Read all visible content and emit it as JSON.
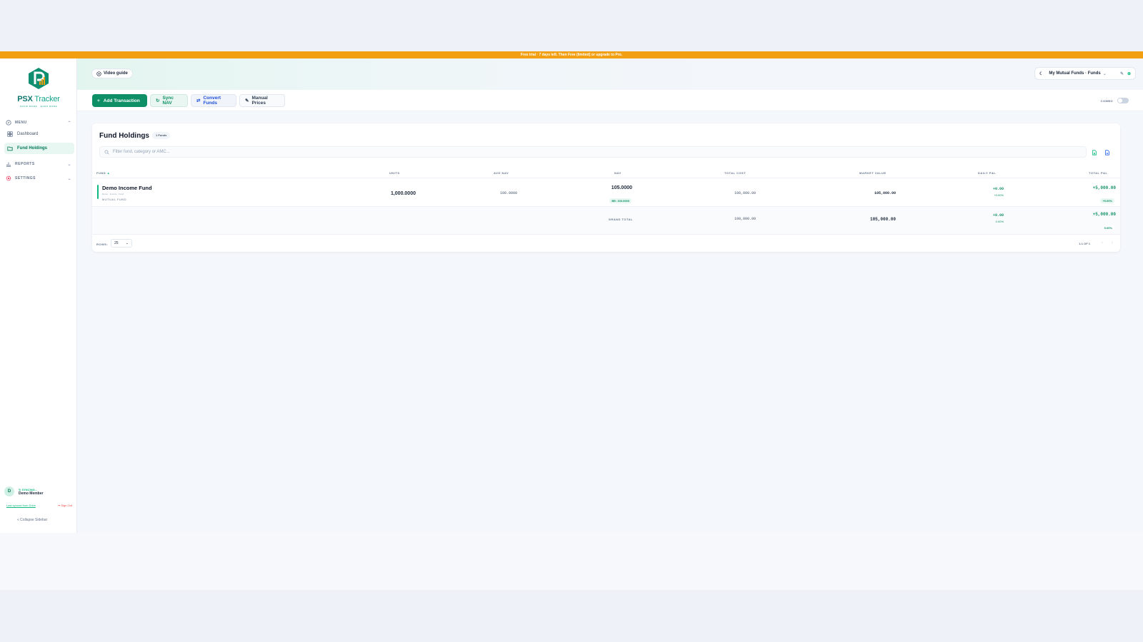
{
  "banner": {
    "text": "Free trial · 7 days left. Then Free (limited) or upgrade to Pro."
  },
  "sidebar": {
    "brand": {
      "name_bold": "PSX",
      "name_light": " Tracker",
      "tagline": "KNOW MORE · EARN MORE"
    },
    "menu_label": "MENU",
    "items": [
      {
        "label": "Dashboard"
      },
      {
        "label": "Fund Holdings"
      }
    ],
    "reports_label": "REPORTS",
    "settings_label": "SETTINGS",
    "user": {
      "initial": "D",
      "status": "SYNCING...",
      "name": "Demo Member"
    },
    "last_synced": "Last synced from Drive",
    "sign_out": "Sign Out",
    "collapse": "Collapse Sidebar"
  },
  "topbar": {
    "video_guide": "Video guide",
    "portfolio": "My Mutual Funds · Funds"
  },
  "toolbar": {
    "add": "Add Transaction",
    "sync": "Sync NAV",
    "convert": "Convert Funds",
    "manual": "Manual Prices",
    "combo": "COMBO"
  },
  "holdings": {
    "title": "Fund Holdings",
    "count": "1 Funds",
    "search_placeholder": "Filter fund, category or AMC...",
    "columns": {
      "fund": "FUND",
      "sort_icon": "▲",
      "units": "UNITS",
      "avg_nav": "AVG NAV",
      "nav": "NAV",
      "total_cost": "TOTAL COST",
      "market_value": "MARKET VALUE",
      "daily_pl": "DAILY P&L",
      "total_pl": "TOTAL P&L"
    },
    "rows": [
      {
        "name": "Demo Income Fund",
        "sub": "Demo · Income · Fund",
        "type": "MUTUAL FUND",
        "units": "1,000.0000",
        "avg_nav": "100.0000",
        "nav": "105.0000",
        "nav_badge": "BE: 100.0000",
        "total_cost": "100,000.00",
        "market_value": "105,000.00",
        "daily_pl": "+0.00",
        "daily_pct": "+0.00%",
        "total_pl": "+5,000.00",
        "total_pct": "+5.00%"
      }
    ],
    "grand_total": {
      "label": "GRAND TOTAL",
      "total_cost": "100,000.00",
      "market_value": "105,000.00",
      "daily_pl": "+0.00",
      "daily_pct": "0.00%",
      "total_pl": "+5,000.00",
      "total_pct": "5.00%"
    },
    "rows_label": "ROWS:",
    "rows_per_page": "25",
    "pagination": "1-1 OF 1"
  }
}
